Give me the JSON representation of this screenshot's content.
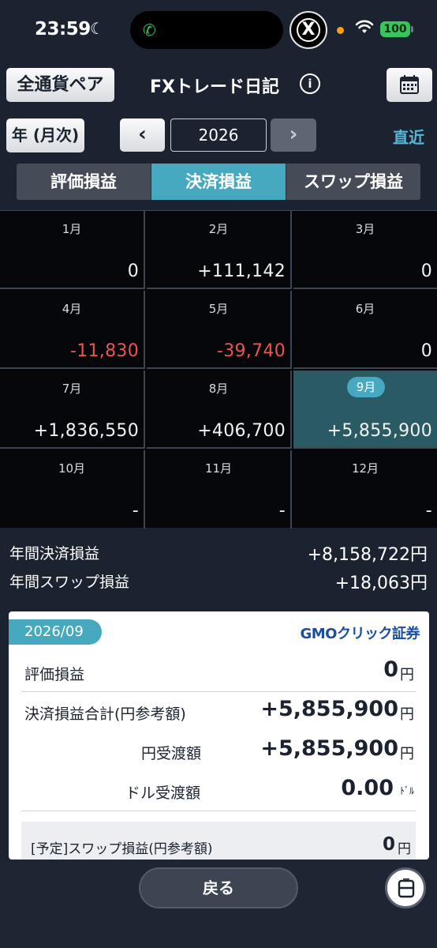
{
  "status_bar": {
    "time": "23:59",
    "battery": "100"
  },
  "header": {
    "pair_button": "全通貨ペア",
    "title": "FXトレード日記",
    "info": "i"
  },
  "period": {
    "mode_button": "年 (月次)",
    "year": "2026",
    "recent_link": "直近",
    "prev": "‹",
    "next": "›"
  },
  "tabs": [
    {
      "label": "評価損益",
      "active": false
    },
    {
      "label": "決済損益",
      "active": true
    },
    {
      "label": "スワップ損益",
      "active": false
    }
  ],
  "months": [
    {
      "month": "1月",
      "value": "0"
    },
    {
      "month": "2月",
      "value": "+111,142"
    },
    {
      "month": "3月",
      "value": "0"
    },
    {
      "month": "4月",
      "value": "-11,830"
    },
    {
      "month": "5月",
      "value": "-39,740"
    },
    {
      "month": "6月",
      "value": "0"
    },
    {
      "month": "7月",
      "value": "+1,836,550"
    },
    {
      "month": "8月",
      "value": "+406,700"
    },
    {
      "month": "9月",
      "value": "+5,855,900"
    },
    {
      "month": "10月",
      "value": "-"
    },
    {
      "month": "11月",
      "value": "-"
    },
    {
      "month": "12月",
      "value": "-"
    }
  ],
  "totals": {
    "settled_label": "年間決済損益",
    "settled_value": "+8,158,722円",
    "swap_label": "年間スワップ損益",
    "swap_value": "+18,063円"
  },
  "detail": {
    "date": "2026/09",
    "logo_gmo": "GMO",
    "logo_rest": "クリック証券",
    "rows": [
      {
        "label": "評価損益",
        "value": "0",
        "unit": "円"
      },
      {
        "label": "決済損益合計(円参考額)",
        "value": "+5,855,900",
        "unit": "円"
      },
      {
        "label": "円受渡額",
        "value": "+5,855,900",
        "unit": "円"
      },
      {
        "label": "ドル受渡額",
        "value": "0.00",
        "unit": "ﾄﾞﾙ"
      }
    ],
    "scheduled": {
      "label": "[予定]スワップ損益(円参考額)",
      "value": "0",
      "unit": "円"
    }
  },
  "bottom": {
    "back_button": "戻る"
  }
}
